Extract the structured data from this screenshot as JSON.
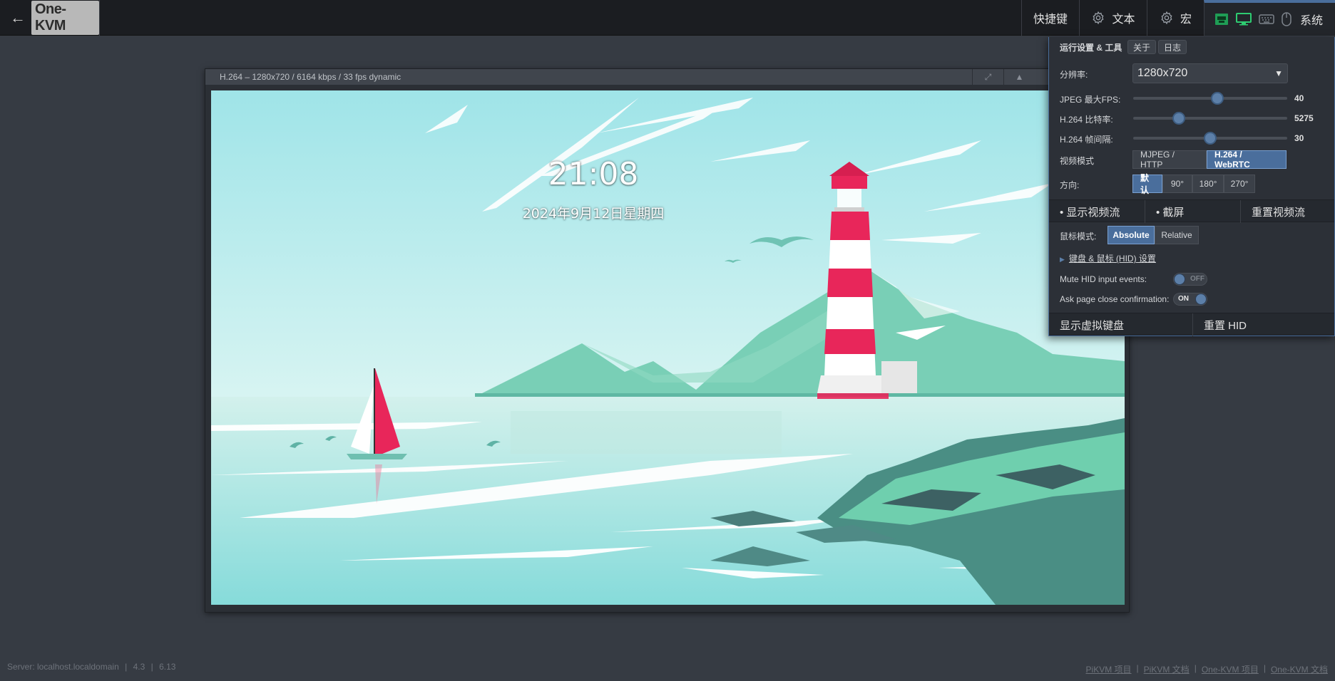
{
  "topbar": {
    "back_glyph": "←",
    "logo": "One-KVM",
    "menu": {
      "shortcuts": "快捷键",
      "text": "文本",
      "macro": "宏",
      "system": "系统"
    },
    "status_icons": [
      "network-icon",
      "monitor-icon",
      "keyboard-icon",
      "mouse-icon"
    ]
  },
  "stream": {
    "title": "H.264 – 1280x720 / 6164 kbps / 33 fps dynamic",
    "screen": {
      "time": "21:08",
      "date": "2024年9月12日星期四"
    }
  },
  "panel": {
    "title": "运行设置 & 工具",
    "about_btn": "关于",
    "log_btn": "日志",
    "resolution_label": "分辨率:",
    "resolution_value": "1280x720",
    "jpeg_fps_label": "JPEG 最大FPS:",
    "jpeg_fps_value": "40",
    "jpeg_fps_fraction": 0.55,
    "h264_bitrate_label": "H.264 比特率:",
    "h264_bitrate_value": "5275",
    "h264_bitrate_fraction": 0.28,
    "h264_gop_label": "H.264 帧间隔:",
    "h264_gop_value": "30",
    "h264_gop_fraction": 0.5,
    "video_mode_label": "视频模式",
    "video_modes": [
      "MJPEG / HTTP",
      "H.264 / WebRTC"
    ],
    "video_mode_active": "H.264 / WebRTC",
    "orientation_label": "方向:",
    "orientations": [
      "默认",
      "90°",
      "180°",
      "270°"
    ],
    "orientation_active": "默认",
    "show_stream": "• 显示视频流",
    "screenshot": "• 截屏",
    "reset_stream": "重置视频流",
    "mouse_mode_label": "鼠标模式:",
    "mouse_modes": [
      "Absolute",
      "Relative"
    ],
    "mouse_mode_active": "Absolute",
    "hid_settings_link": "键盘 & 鼠标 (HID) 设置",
    "mute_hid_label": "Mute HID input events:",
    "mute_hid_state": "OFF",
    "ask_close_label": "Ask page close confirmation:",
    "ask_close_state": "ON",
    "show_keyboard": "显示虚拟键盘",
    "reset_hid": "重置 HID"
  },
  "footer": {
    "server": "Server: localhost.localdomain",
    "version1": "4.3",
    "version2": "6.13",
    "sep": "|",
    "links": [
      "PiKVM 项目",
      "PiKVM 文档",
      "One-KVM 项目",
      "One-KVM 文档"
    ]
  },
  "colors": {
    "accent": "#4a6e9c",
    "status_green": "#2ecc71",
    "background": "#363b43"
  }
}
